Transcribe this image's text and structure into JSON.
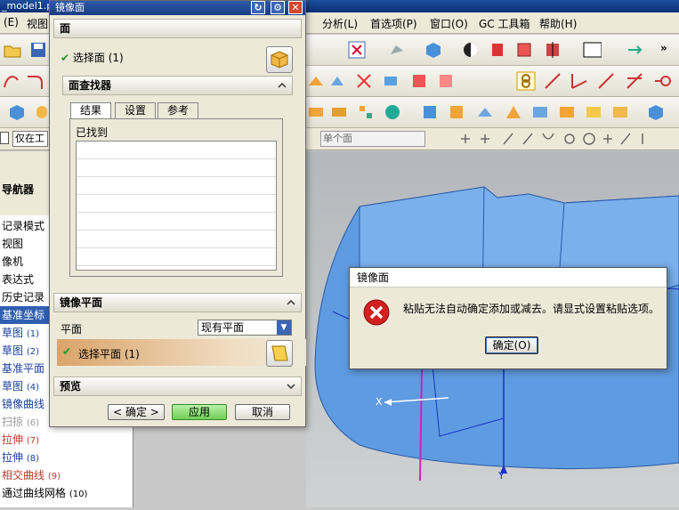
{
  "window": {
    "title": "_model1.p"
  },
  "menubar": {
    "left_items": [
      "(E)",
      "视图"
    ],
    "right_items": [
      "分析(L)",
      "首选项(P)",
      "窗口(O)",
      "GC 工具箱",
      "帮助(H)"
    ]
  },
  "selection_bar": {
    "filter_value": "仅在工",
    "scope_value": "单个面"
  },
  "navigator": {
    "title": "导航器",
    "items": [
      {
        "label": "记录模式",
        "num": ""
      },
      {
        "label": "视图",
        "num": ""
      },
      {
        "label": "像机",
        "num": ""
      },
      {
        "label": "表达式",
        "num": ""
      },
      {
        "label": "历史记录",
        "num": ""
      },
      {
        "label": "基准坐标",
        "num": ""
      },
      {
        "label": "草图",
        "num": "(1)"
      },
      {
        "label": "草图",
        "num": "(2)"
      },
      {
        "label": "基准平面",
        "num": ""
      },
      {
        "label": "草图",
        "num": "(4)"
      },
      {
        "label": "镜像曲线",
        "num": ""
      },
      {
        "label": "扫掠",
        "num": "(6)"
      },
      {
        "label": "拉伸",
        "num": "(7)"
      },
      {
        "label": "拉伸",
        "num": "(8)"
      },
      {
        "label": "相交曲线",
        "num": "(9)"
      },
      {
        "label": "通过曲线网格",
        "num": "(10)"
      }
    ]
  },
  "mirror_dialog": {
    "title": "镜像面",
    "face_section": "面",
    "select_face": "选择面 (1)",
    "finder_section": "面查找器",
    "tabs": [
      "结果",
      "设置",
      "参考"
    ],
    "found_label": "已找到",
    "mirror_plane_section": "镜像平面",
    "plane_label": "平面",
    "plane_option": "现有平面",
    "select_plane": "选择平面 (1)",
    "preview_section": "预览",
    "ok_button": "< 确定 >",
    "apply_button": "应用",
    "cancel_button": "取消"
  },
  "error_dialog": {
    "title": "镜像面",
    "message": "粘贴无法自动确定添加或减去。请显式设置粘贴选项。",
    "ok_button": "确定(O)"
  },
  "viewport": {
    "x_axis": "X",
    "y_axis": "Y"
  },
  "colors": {
    "accent": "#2f5fb0",
    "model_blue": "#5f9be0",
    "select_orange": "#d9a46a",
    "error_red": "#d21f1f"
  }
}
